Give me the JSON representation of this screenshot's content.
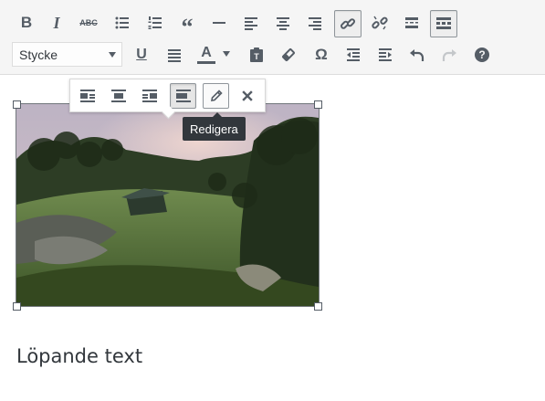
{
  "toolbar": {
    "row1": [
      {
        "name": "bold-button",
        "icon": "bold-icon"
      },
      {
        "name": "italic-button",
        "icon": "italic-icon"
      },
      {
        "name": "strikethrough-button",
        "icon": "strikethrough-icon",
        "label": "ABC"
      },
      {
        "name": "bullet-list-button",
        "icon": "bullet-list-icon"
      },
      {
        "name": "numbered-list-button",
        "icon": "numbered-list-icon"
      },
      {
        "name": "blockquote-button",
        "icon": "quote-icon"
      },
      {
        "name": "horizontal-line-button",
        "icon": "hr-icon"
      },
      {
        "name": "align-left-button",
        "icon": "align-left-icon"
      },
      {
        "name": "align-center-button",
        "icon": "align-center-icon"
      },
      {
        "name": "align-right-button",
        "icon": "align-right-icon"
      },
      {
        "name": "insert-link-button",
        "icon": "link-icon",
        "active": true
      },
      {
        "name": "remove-link-button",
        "icon": "unlink-icon"
      },
      {
        "name": "read-more-button",
        "icon": "read-more-icon"
      },
      {
        "name": "toolbar-toggle-button",
        "icon": "kitchen-sink-icon",
        "active": true
      }
    ],
    "row2": [
      {
        "name": "underline-button",
        "icon": "underline-icon"
      },
      {
        "name": "justify-button",
        "icon": "justify-icon"
      },
      {
        "name": "text-color-button",
        "icon": "text-color-icon",
        "label": "A"
      },
      {
        "name": "paste-text-button",
        "icon": "paste-icon"
      },
      {
        "name": "clear-formatting-button",
        "icon": "eraser-icon"
      },
      {
        "name": "special-character-button",
        "icon": "omega-icon",
        "label": "Ω"
      },
      {
        "name": "outdent-button",
        "icon": "outdent-icon"
      },
      {
        "name": "indent-button",
        "icon": "indent-icon"
      },
      {
        "name": "undo-button",
        "icon": "undo-icon"
      },
      {
        "name": "redo-button",
        "icon": "redo-icon",
        "disabled": true
      },
      {
        "name": "help-button",
        "icon": "help-icon",
        "label": "?"
      }
    ],
    "format_select": {
      "value": "Stycke"
    }
  },
  "image_toolbar": {
    "buttons": [
      {
        "name": "image-align-left-button",
        "icon": "align-left-icon"
      },
      {
        "name": "image-align-center-button",
        "icon": "align-center-icon"
      },
      {
        "name": "image-align-right-button",
        "icon": "align-right-icon"
      },
      {
        "name": "image-align-none-button",
        "icon": "align-none-icon",
        "active": true
      },
      {
        "name": "image-edit-button",
        "icon": "pencil-icon",
        "hover": true
      },
      {
        "name": "image-remove-button",
        "icon": "close-icon"
      }
    ],
    "tooltip": "Redigera"
  },
  "content": {
    "image": {
      "subject": "landscape photo with cabin, trees and meadow"
    },
    "paragraph": "Löpande text"
  },
  "colors": {
    "toolbar_bg": "#f5f5f5",
    "icon": "#555d66",
    "active_border": "#8f959a",
    "tooltip_bg": "#32373c",
    "text": "#32373c"
  }
}
